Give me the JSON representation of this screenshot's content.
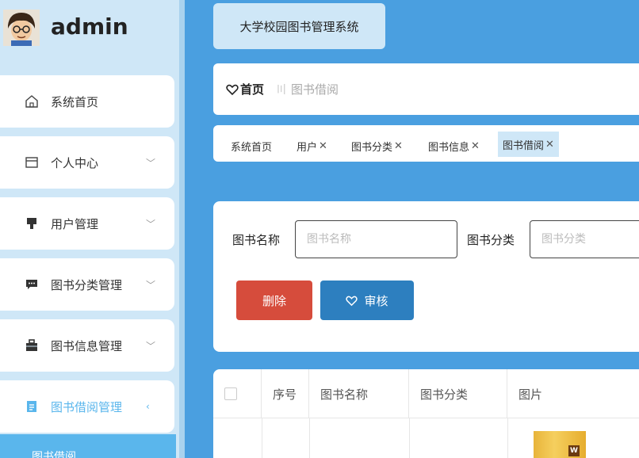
{
  "brand": {
    "name": "admin"
  },
  "sidebar": {
    "items": [
      {
        "label": "系统首页",
        "icon": "home-icon",
        "arrow": ""
      },
      {
        "label": "个人中心",
        "icon": "card-icon",
        "arrow": "﹀"
      },
      {
        "label": "用户管理",
        "icon": "user-manage-icon",
        "arrow": "﹀"
      },
      {
        "label": "图书分类管理",
        "icon": "chat-icon",
        "arrow": "﹀"
      },
      {
        "label": "图书信息管理",
        "icon": "briefcase-icon",
        "arrow": "﹀"
      },
      {
        "label": "图书借阅管理",
        "icon": "document-icon",
        "arrow": "‹"
      }
    ],
    "submenu": {
      "label": "图书借阅"
    },
    "active_color": "#5ab6ec"
  },
  "header": {
    "title": "大学校园图书管理系统"
  },
  "breadcrumb": {
    "home": "首页",
    "separator": "〣",
    "current": "图书借阅"
  },
  "tags": [
    {
      "label": "系统首页",
      "closable": false
    },
    {
      "label": "用户",
      "closable": true
    },
    {
      "label": "图书分类",
      "closable": true
    },
    {
      "label": "图书信息",
      "closable": true
    },
    {
      "label": "图书借阅",
      "closable": true
    }
  ],
  "search": {
    "book_name_label": "图书名称",
    "book_name_placeholder": "图书名称",
    "category_label": "图书分类",
    "category_placeholder": "图书分类"
  },
  "actions": {
    "delete_label": "删除",
    "audit_label": "审核"
  },
  "table": {
    "columns": [
      "序号",
      "图书名称",
      "图书分类",
      "图片"
    ]
  },
  "colors": {
    "background": "#4a9fe0",
    "delete": "#d64c3c",
    "audit": "#2d7fbf",
    "sidebar": "#cfe7f7"
  }
}
